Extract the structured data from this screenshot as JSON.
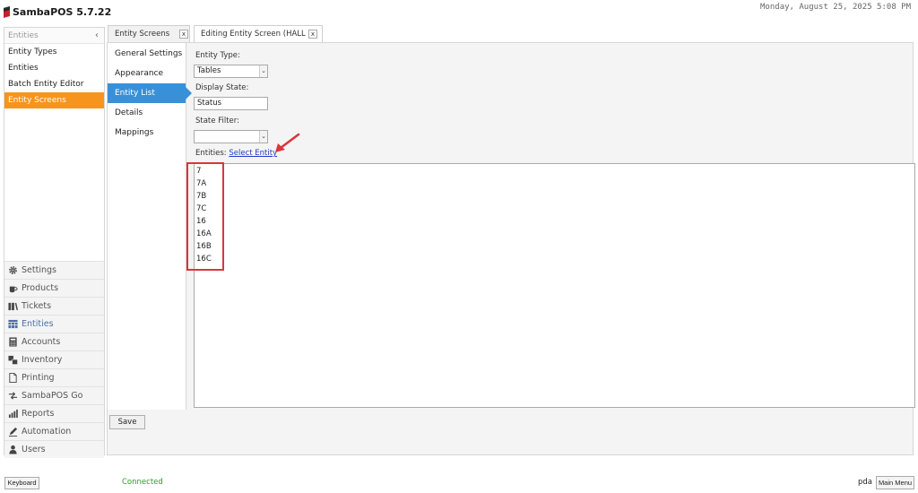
{
  "app": {
    "title": "SambaPOS 5.7.22",
    "datetime": "Monday, August 25, 2025 5:08 PM",
    "logo_icon": "sambapos-logo-icon"
  },
  "sidebar": {
    "header": "Entities",
    "collapse_glyph": "‹",
    "sub_items": [
      {
        "label": "Entity Types"
      },
      {
        "label": "Entities"
      },
      {
        "label": "Batch Entity Editor"
      },
      {
        "label": "Entity Screens",
        "active": true
      }
    ],
    "nav": [
      {
        "label": "Settings",
        "icon": "gear-icon"
      },
      {
        "label": "Products",
        "icon": "coffee-cup-icon"
      },
      {
        "label": "Tickets",
        "icon": "tickets-icon"
      },
      {
        "label": "Entities",
        "icon": "table-grid-icon",
        "current": true
      },
      {
        "label": "Accounts",
        "icon": "calculator-icon"
      },
      {
        "label": "Inventory",
        "icon": "inventory-icon"
      },
      {
        "label": "Printing",
        "icon": "document-icon"
      },
      {
        "label": "SambaPOS Go",
        "icon": "arrows-icon"
      },
      {
        "label": "Reports",
        "icon": "bar-chart-icon"
      },
      {
        "label": "Automation",
        "icon": "pencil-icon"
      },
      {
        "label": "Users",
        "icon": "user-icon"
      }
    ]
  },
  "tabs": [
    {
      "label": "Entity Screens",
      "close": "x"
    },
    {
      "label": "Editing Entity Screen (HALL B)",
      "close": "x",
      "active": true
    }
  ],
  "sections": [
    {
      "label": "General Settings"
    },
    {
      "label": "Appearance"
    },
    {
      "label": "Entity List",
      "active": true
    },
    {
      "label": "Details"
    },
    {
      "label": "Mappings"
    }
  ],
  "form": {
    "entity_type_label": "Entity Type:",
    "entity_type_value": "Tables",
    "display_state_label": "Display State:",
    "display_state_value": "Status",
    "state_filter_label": "State Filter:",
    "state_filter_value": "",
    "combo_arrow": "⌄",
    "entities_label": "Entities:",
    "select_entity_link": "Select Entity",
    "entities": [
      "7",
      "7A",
      "7B",
      "7C",
      "16",
      "16A",
      "16B",
      "16C"
    ],
    "save_label": "Save"
  },
  "statusbar": {
    "keyboard_label": "Keyboard",
    "connection": "Connected",
    "user": "pda",
    "main_menu_label": "Main Menu"
  },
  "colors": {
    "active_sidebar": "#f7941d",
    "active_section": "#3891d8",
    "highlight": "#d9363e",
    "connected": "#2e9a2e",
    "link": "#1f3cc4"
  }
}
